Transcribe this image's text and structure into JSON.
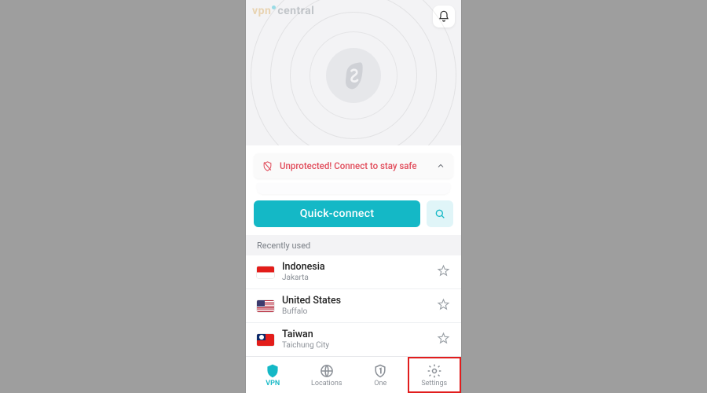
{
  "watermark": {
    "part1": "vpn",
    "part2": "central"
  },
  "status": {
    "text": "Unprotected! Connect to stay safe"
  },
  "actions": {
    "quick_connect": "Quick-connect"
  },
  "recent": {
    "header": "Recently used",
    "items": [
      {
        "country": "Indonesia",
        "city": "Jakarta",
        "flag": "id"
      },
      {
        "country": "United States",
        "city": "Buffalo",
        "flag": "us"
      },
      {
        "country": "Taiwan",
        "city": "Taichung City",
        "flag": "tw"
      }
    ]
  },
  "tabs": {
    "vpn": "VPN",
    "locations": "Locations",
    "one": "One",
    "settings": "Settings",
    "active": "vpn",
    "highlighted": "settings"
  }
}
